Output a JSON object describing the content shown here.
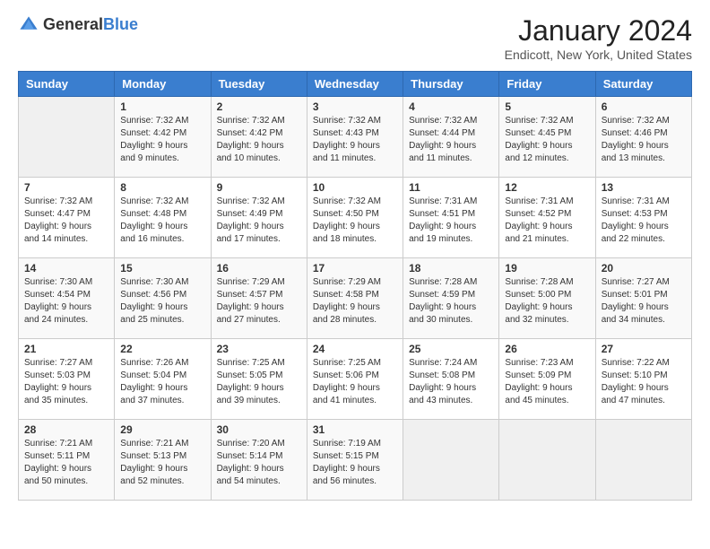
{
  "header": {
    "logo_general": "General",
    "logo_blue": "Blue",
    "month_title": "January 2024",
    "location": "Endicott, New York, United States"
  },
  "weekdays": [
    "Sunday",
    "Monday",
    "Tuesday",
    "Wednesday",
    "Thursday",
    "Friday",
    "Saturday"
  ],
  "weeks": [
    [
      {
        "day": "",
        "sunrise": "",
        "sunset": "",
        "daylight": ""
      },
      {
        "day": "1",
        "sunrise": "Sunrise: 7:32 AM",
        "sunset": "Sunset: 4:42 PM",
        "daylight": "Daylight: 9 hours and 9 minutes."
      },
      {
        "day": "2",
        "sunrise": "Sunrise: 7:32 AM",
        "sunset": "Sunset: 4:42 PM",
        "daylight": "Daylight: 9 hours and 10 minutes."
      },
      {
        "day": "3",
        "sunrise": "Sunrise: 7:32 AM",
        "sunset": "Sunset: 4:43 PM",
        "daylight": "Daylight: 9 hours and 11 minutes."
      },
      {
        "day": "4",
        "sunrise": "Sunrise: 7:32 AM",
        "sunset": "Sunset: 4:44 PM",
        "daylight": "Daylight: 9 hours and 11 minutes."
      },
      {
        "day": "5",
        "sunrise": "Sunrise: 7:32 AM",
        "sunset": "Sunset: 4:45 PM",
        "daylight": "Daylight: 9 hours and 12 minutes."
      },
      {
        "day": "6",
        "sunrise": "Sunrise: 7:32 AM",
        "sunset": "Sunset: 4:46 PM",
        "daylight": "Daylight: 9 hours and 13 minutes."
      }
    ],
    [
      {
        "day": "7",
        "sunrise": "Sunrise: 7:32 AM",
        "sunset": "Sunset: 4:47 PM",
        "daylight": "Daylight: 9 hours and 14 minutes."
      },
      {
        "day": "8",
        "sunrise": "Sunrise: 7:32 AM",
        "sunset": "Sunset: 4:48 PM",
        "daylight": "Daylight: 9 hours and 16 minutes."
      },
      {
        "day": "9",
        "sunrise": "Sunrise: 7:32 AM",
        "sunset": "Sunset: 4:49 PM",
        "daylight": "Daylight: 9 hours and 17 minutes."
      },
      {
        "day": "10",
        "sunrise": "Sunrise: 7:32 AM",
        "sunset": "Sunset: 4:50 PM",
        "daylight": "Daylight: 9 hours and 18 minutes."
      },
      {
        "day": "11",
        "sunrise": "Sunrise: 7:31 AM",
        "sunset": "Sunset: 4:51 PM",
        "daylight": "Daylight: 9 hours and 19 minutes."
      },
      {
        "day": "12",
        "sunrise": "Sunrise: 7:31 AM",
        "sunset": "Sunset: 4:52 PM",
        "daylight": "Daylight: 9 hours and 21 minutes."
      },
      {
        "day": "13",
        "sunrise": "Sunrise: 7:31 AM",
        "sunset": "Sunset: 4:53 PM",
        "daylight": "Daylight: 9 hours and 22 minutes."
      }
    ],
    [
      {
        "day": "14",
        "sunrise": "Sunrise: 7:30 AM",
        "sunset": "Sunset: 4:54 PM",
        "daylight": "Daylight: 9 hours and 24 minutes."
      },
      {
        "day": "15",
        "sunrise": "Sunrise: 7:30 AM",
        "sunset": "Sunset: 4:56 PM",
        "daylight": "Daylight: 9 hours and 25 minutes."
      },
      {
        "day": "16",
        "sunrise": "Sunrise: 7:29 AM",
        "sunset": "Sunset: 4:57 PM",
        "daylight": "Daylight: 9 hours and 27 minutes."
      },
      {
        "day": "17",
        "sunrise": "Sunrise: 7:29 AM",
        "sunset": "Sunset: 4:58 PM",
        "daylight": "Daylight: 9 hours and 28 minutes."
      },
      {
        "day": "18",
        "sunrise": "Sunrise: 7:28 AM",
        "sunset": "Sunset: 4:59 PM",
        "daylight": "Daylight: 9 hours and 30 minutes."
      },
      {
        "day": "19",
        "sunrise": "Sunrise: 7:28 AM",
        "sunset": "Sunset: 5:00 PM",
        "daylight": "Daylight: 9 hours and 32 minutes."
      },
      {
        "day": "20",
        "sunrise": "Sunrise: 7:27 AM",
        "sunset": "Sunset: 5:01 PM",
        "daylight": "Daylight: 9 hours and 34 minutes."
      }
    ],
    [
      {
        "day": "21",
        "sunrise": "Sunrise: 7:27 AM",
        "sunset": "Sunset: 5:03 PM",
        "daylight": "Daylight: 9 hours and 35 minutes."
      },
      {
        "day": "22",
        "sunrise": "Sunrise: 7:26 AM",
        "sunset": "Sunset: 5:04 PM",
        "daylight": "Daylight: 9 hours and 37 minutes."
      },
      {
        "day": "23",
        "sunrise": "Sunrise: 7:25 AM",
        "sunset": "Sunset: 5:05 PM",
        "daylight": "Daylight: 9 hours and 39 minutes."
      },
      {
        "day": "24",
        "sunrise": "Sunrise: 7:25 AM",
        "sunset": "Sunset: 5:06 PM",
        "daylight": "Daylight: 9 hours and 41 minutes."
      },
      {
        "day": "25",
        "sunrise": "Sunrise: 7:24 AM",
        "sunset": "Sunset: 5:08 PM",
        "daylight": "Daylight: 9 hours and 43 minutes."
      },
      {
        "day": "26",
        "sunrise": "Sunrise: 7:23 AM",
        "sunset": "Sunset: 5:09 PM",
        "daylight": "Daylight: 9 hours and 45 minutes."
      },
      {
        "day": "27",
        "sunrise": "Sunrise: 7:22 AM",
        "sunset": "Sunset: 5:10 PM",
        "daylight": "Daylight: 9 hours and 47 minutes."
      }
    ],
    [
      {
        "day": "28",
        "sunrise": "Sunrise: 7:21 AM",
        "sunset": "Sunset: 5:11 PM",
        "daylight": "Daylight: 9 hours and 50 minutes."
      },
      {
        "day": "29",
        "sunrise": "Sunrise: 7:21 AM",
        "sunset": "Sunset: 5:13 PM",
        "daylight": "Daylight: 9 hours and 52 minutes."
      },
      {
        "day": "30",
        "sunrise": "Sunrise: 7:20 AM",
        "sunset": "Sunset: 5:14 PM",
        "daylight": "Daylight: 9 hours and 54 minutes."
      },
      {
        "day": "31",
        "sunrise": "Sunrise: 7:19 AM",
        "sunset": "Sunset: 5:15 PM",
        "daylight": "Daylight: 9 hours and 56 minutes."
      },
      {
        "day": "",
        "sunrise": "",
        "sunset": "",
        "daylight": ""
      },
      {
        "day": "",
        "sunrise": "",
        "sunset": "",
        "daylight": ""
      },
      {
        "day": "",
        "sunrise": "",
        "sunset": "",
        "daylight": ""
      }
    ]
  ]
}
